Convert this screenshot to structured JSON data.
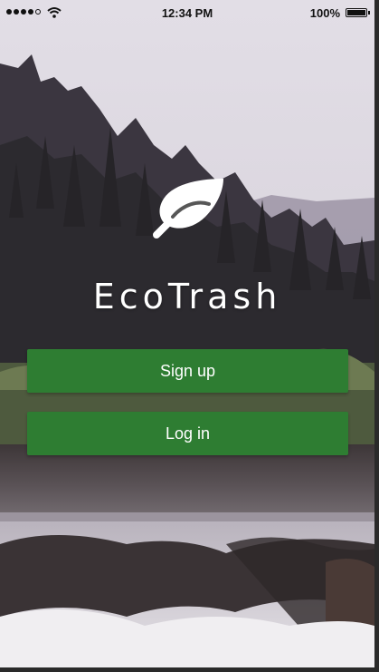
{
  "status_bar": {
    "time": "12:34 PM",
    "battery_percent": "100%",
    "signal_bars": 4,
    "signal_max": 5
  },
  "app": {
    "title": "EcoTrash",
    "logo_icon": "leaf-icon"
  },
  "buttons": {
    "signup_label": "Sign up",
    "login_label": "Log in"
  },
  "colors": {
    "button": "#2e7d32",
    "title_text": "#ffffff"
  }
}
